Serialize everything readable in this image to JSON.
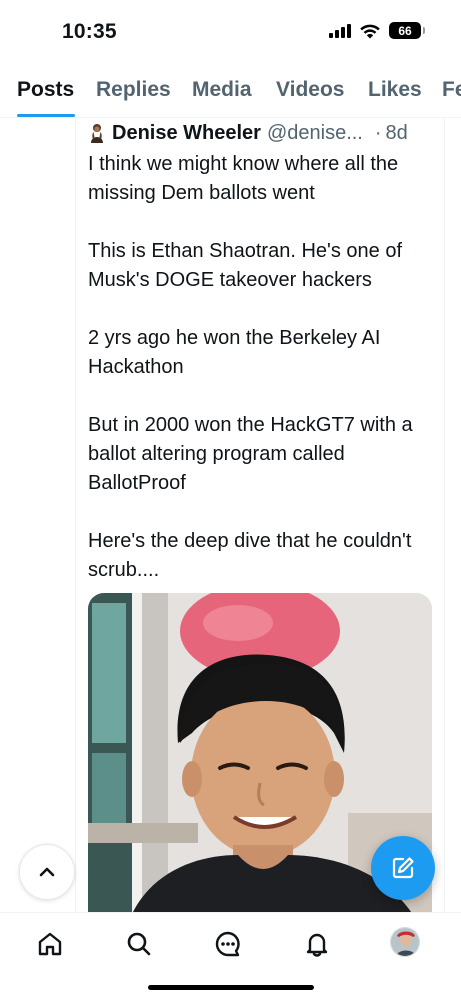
{
  "status_bar": {
    "time": "10:35",
    "battery": "66"
  },
  "tabs": [
    {
      "label": "Posts",
      "active": true
    },
    {
      "label": "Replies",
      "active": false
    },
    {
      "label": "Media",
      "active": false
    },
    {
      "label": "Videos",
      "active": false
    },
    {
      "label": "Likes",
      "active": false
    },
    {
      "label": "Fe",
      "active": false
    }
  ],
  "post": {
    "author_name": "Denise Wheeler",
    "author_handle": "@denise...",
    "separator": "·",
    "time": "8d",
    "paragraphs": [
      "I think we might know where all the missing Dem ballots went",
      "This is Ethan Shaotran. He's one of Musk's DOGE takeover hackers",
      "2 yrs ago he won the Berkeley AI Hackathon",
      "But in 2000 won the HackGT7 with a ballot altering program called BallotProof",
      "Here's the deep dive that he couldn't scrub...."
    ]
  },
  "icons": {
    "signal": "signal-icon",
    "wifi": "wifi-icon",
    "battery": "battery-icon",
    "scroll_top": "chevron-up-icon",
    "compose": "compose-icon",
    "home": "home-icon",
    "search": "search-icon",
    "messages": "messages-icon",
    "notifications": "bell-icon"
  },
  "colors": {
    "accent": "#1d9bf0",
    "text_primary": "#0f1419",
    "text_secondary": "#536471"
  }
}
